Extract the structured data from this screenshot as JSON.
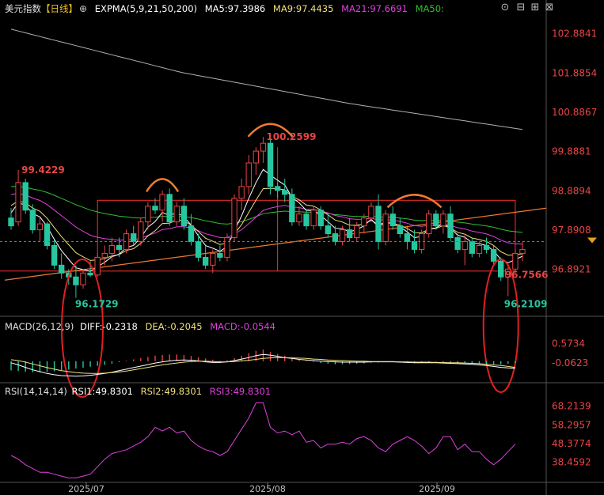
{
  "header": {
    "symbol": "美元指数",
    "period": "【日线】",
    "period_icon": "plus-circle-icon",
    "expma_label": "EXPMA(5,9,21,50,200)",
    "ma5": "MA5:97.3986",
    "ma9": "MA9:97.4435",
    "ma21": "MA21:97.6691",
    "ma50": "MA50:",
    "toolbar_icons": [
      "target-icon",
      "minus-box-icon",
      "plus-box-icon",
      "close-box-icon"
    ]
  },
  "colors": {
    "up": "#e84545",
    "down": "#26c6a0",
    "ma5": "#ffffff",
    "ma9": "#f0e080",
    "ma21": "#e040e0",
    "ma50": "#30c030",
    "ma200": "#b0b0b0",
    "orange": "#f07a30",
    "axis_text": "#e84545",
    "date_text": "#c0c0c0"
  },
  "chart_data": [
    {
      "type": "candlestick",
      "title": "美元指数【日线】",
      "y_ticks": [
        102.8841,
        101.8854,
        100.8867,
        99.8881,
        98.8894,
        97.8908,
        96.8921
      ],
      "ylim": [
        95.7,
        103.3
      ],
      "current_price": 97.6,
      "annotations": [
        {
          "label": "99.4229",
          "value": 99.4229
        },
        {
          "label": "96.1729",
          "value": 96.1729
        },
        {
          "label": "100.2599",
          "value": 100.2599
        },
        {
          "label": "96.7566",
          "value": 96.7566
        },
        {
          "label": "96.2109",
          "value": 96.2109
        }
      ],
      "candles": [
        {
          "o": 98.2,
          "h": 98.45,
          "l": 97.9,
          "c": 98.0
        },
        {
          "o": 98.1,
          "h": 99.42,
          "l": 98.0,
          "c": 99.1
        },
        {
          "o": 99.1,
          "h": 99.2,
          "l": 98.3,
          "c": 98.4
        },
        {
          "o": 98.4,
          "h": 98.55,
          "l": 97.8,
          "c": 97.9
        },
        {
          "o": 97.9,
          "h": 98.2,
          "l": 97.6,
          "c": 98.05
        },
        {
          "o": 98.05,
          "h": 98.1,
          "l": 97.4,
          "c": 97.5
        },
        {
          "o": 97.5,
          "h": 97.65,
          "l": 96.9,
          "c": 97.0
        },
        {
          "o": 97.0,
          "h": 97.3,
          "l": 96.65,
          "c": 96.8
        },
        {
          "o": 96.8,
          "h": 96.9,
          "l": 96.5,
          "c": 96.7
        },
        {
          "o": 96.7,
          "h": 97.0,
          "l": 96.17,
          "c": 96.5
        },
        {
          "o": 96.5,
          "h": 96.9,
          "l": 96.4,
          "c": 96.8
        },
        {
          "o": 96.8,
          "h": 97.1,
          "l": 96.7,
          "c": 96.75
        },
        {
          "o": 96.75,
          "h": 97.3,
          "l": 96.7,
          "c": 97.2
        },
        {
          "o": 97.2,
          "h": 97.5,
          "l": 97.0,
          "c": 97.3
        },
        {
          "o": 97.3,
          "h": 97.7,
          "l": 97.1,
          "c": 97.5
        },
        {
          "o": 97.5,
          "h": 97.7,
          "l": 97.2,
          "c": 97.4
        },
        {
          "o": 97.4,
          "h": 97.9,
          "l": 97.3,
          "c": 97.8
        },
        {
          "o": 97.8,
          "h": 98.0,
          "l": 97.5,
          "c": 97.6
        },
        {
          "o": 97.6,
          "h": 98.2,
          "l": 97.5,
          "c": 98.1
        },
        {
          "o": 98.1,
          "h": 98.6,
          "l": 97.9,
          "c": 98.5
        },
        {
          "o": 98.5,
          "h": 98.7,
          "l": 98.3,
          "c": 98.4
        },
        {
          "o": 98.4,
          "h": 98.9,
          "l": 98.1,
          "c": 98.8
        },
        {
          "o": 98.8,
          "h": 98.95,
          "l": 98.0,
          "c": 98.1
        },
        {
          "o": 98.1,
          "h": 98.6,
          "l": 98.0,
          "c": 98.5
        },
        {
          "o": 98.5,
          "h": 98.7,
          "l": 97.9,
          "c": 98.0
        },
        {
          "o": 98.0,
          "h": 98.3,
          "l": 97.5,
          "c": 97.6
        },
        {
          "o": 97.6,
          "h": 97.8,
          "l": 97.1,
          "c": 97.2
        },
        {
          "o": 97.2,
          "h": 97.5,
          "l": 96.9,
          "c": 97.0
        },
        {
          "o": 97.0,
          "h": 97.4,
          "l": 96.8,
          "c": 97.3
        },
        {
          "o": 97.3,
          "h": 97.5,
          "l": 97.1,
          "c": 97.2
        },
        {
          "o": 97.2,
          "h": 97.8,
          "l": 97.1,
          "c": 97.7
        },
        {
          "o": 97.7,
          "h": 98.8,
          "l": 97.6,
          "c": 98.7
        },
        {
          "o": 98.7,
          "h": 99.2,
          "l": 98.4,
          "c": 99.0
        },
        {
          "o": 99.0,
          "h": 99.8,
          "l": 98.8,
          "c": 99.6
        },
        {
          "o": 99.6,
          "h": 100.0,
          "l": 99.3,
          "c": 99.9
        },
        {
          "o": 99.9,
          "h": 100.26,
          "l": 99.6,
          "c": 100.1
        },
        {
          "o": 100.1,
          "h": 100.2,
          "l": 98.8,
          "c": 99.0
        },
        {
          "o": 99.0,
          "h": 99.1,
          "l": 98.7,
          "c": 98.9
        },
        {
          "o": 98.9,
          "h": 99.2,
          "l": 98.6,
          "c": 98.8
        },
        {
          "o": 98.8,
          "h": 98.95,
          "l": 98.0,
          "c": 98.1
        },
        {
          "o": 98.1,
          "h": 98.5,
          "l": 98.0,
          "c": 98.3
        },
        {
          "o": 98.3,
          "h": 98.4,
          "l": 97.9,
          "c": 98.0
        },
        {
          "o": 98.0,
          "h": 98.5,
          "l": 97.9,
          "c": 98.4
        },
        {
          "o": 98.4,
          "h": 98.5,
          "l": 97.9,
          "c": 98.0
        },
        {
          "o": 98.0,
          "h": 98.3,
          "l": 97.7,
          "c": 97.8
        },
        {
          "o": 97.8,
          "h": 98.0,
          "l": 97.5,
          "c": 97.6
        },
        {
          "o": 97.6,
          "h": 98.0,
          "l": 97.5,
          "c": 97.9
        },
        {
          "o": 97.9,
          "h": 98.2,
          "l": 97.6,
          "c": 97.7
        },
        {
          "o": 97.7,
          "h": 98.1,
          "l": 97.6,
          "c": 98.0
        },
        {
          "o": 98.0,
          "h": 98.3,
          "l": 97.8,
          "c": 98.2
        },
        {
          "o": 98.2,
          "h": 98.6,
          "l": 98.1,
          "c": 98.5
        },
        {
          "o": 98.5,
          "h": 98.8,
          "l": 97.4,
          "c": 97.6
        },
        {
          "o": 97.6,
          "h": 98.4,
          "l": 97.5,
          "c": 98.3
        },
        {
          "o": 98.3,
          "h": 98.5,
          "l": 97.9,
          "c": 98.0
        },
        {
          "o": 98.0,
          "h": 98.2,
          "l": 97.7,
          "c": 97.8
        },
        {
          "o": 97.8,
          "h": 98.0,
          "l": 97.4,
          "c": 97.6
        },
        {
          "o": 97.6,
          "h": 97.9,
          "l": 97.3,
          "c": 97.4
        },
        {
          "o": 97.4,
          "h": 97.9,
          "l": 97.3,
          "c": 97.8
        },
        {
          "o": 97.8,
          "h": 98.4,
          "l": 97.7,
          "c": 98.3
        },
        {
          "o": 98.3,
          "h": 98.4,
          "l": 97.9,
          "c": 98.0
        },
        {
          "o": 98.0,
          "h": 98.4,
          "l": 97.8,
          "c": 98.3
        },
        {
          "o": 98.3,
          "h": 98.5,
          "l": 97.6,
          "c": 97.7
        },
        {
          "o": 97.7,
          "h": 97.8,
          "l": 97.3,
          "c": 97.4
        },
        {
          "o": 97.4,
          "h": 97.8,
          "l": 97.0,
          "c": 97.6
        },
        {
          "o": 97.6,
          "h": 97.7,
          "l": 97.2,
          "c": 97.3
        },
        {
          "o": 97.3,
          "h": 97.6,
          "l": 97.2,
          "c": 97.5
        },
        {
          "o": 97.5,
          "h": 97.7,
          "l": 97.3,
          "c": 97.4
        },
        {
          "o": 97.4,
          "h": 97.5,
          "l": 97.0,
          "c": 97.1
        },
        {
          "o": 97.1,
          "h": 97.2,
          "l": 96.6,
          "c": 96.7
        },
        {
          "o": 96.7,
          "h": 97.0,
          "l": 96.21,
          "c": 96.9
        },
        {
          "o": 96.9,
          "h": 97.4,
          "l": 96.8,
          "c": 97.3
        },
        {
          "o": 97.3,
          "h": 97.6,
          "l": 97.1,
          "c": 97.4
        }
      ],
      "ema200": [
        103.0,
        101.9,
        101.1,
        100.45
      ],
      "rect_box": {
        "top": 98.65,
        "bottom": 96.85,
        "start_index": 12,
        "end_index": 70
      },
      "center_line_index": 37
    },
    {
      "type": "bar",
      "title": "MACD(26,12,9)",
      "legend": {
        "diff": "DIFF:-0.2318",
        "dea": "DEA:-0.2045",
        "macd": "MACD:-0.0544"
      },
      "y_ticks": [
        0.5734,
        -0.0623
      ],
      "ylim": [
        -0.65,
        0.95
      ],
      "hist": [
        -0.3,
        -0.32,
        -0.34,
        -0.36,
        -0.36,
        -0.35,
        -0.33,
        -0.3,
        -0.27,
        -0.24,
        -0.21,
        -0.18,
        -0.15,
        -0.12,
        -0.08,
        -0.03,
        0.02,
        0.06,
        0.1,
        0.14,
        0.18,
        0.2,
        0.22,
        0.22,
        0.2,
        0.17,
        0.13,
        0.09,
        0.05,
        0.02,
        0.04,
        0.1,
        0.18,
        0.26,
        0.34,
        0.38,
        0.3,
        0.24,
        0.18,
        0.12,
        0.06,
        0.02,
        -0.02,
        -0.06,
        -0.08,
        -0.1,
        -0.1,
        -0.09,
        -0.08,
        -0.07,
        -0.05,
        -0.04,
        -0.03,
        -0.02,
        -0.02,
        -0.03,
        -0.04,
        -0.03,
        -0.02,
        -0.02,
        -0.03,
        -0.04,
        -0.05,
        -0.06,
        -0.07,
        -0.08,
        -0.09,
        -0.1,
        -0.1,
        -0.08,
        -0.06
      ],
      "diff": [
        -0.05,
        -0.12,
        -0.2,
        -0.28,
        -0.34,
        -0.4,
        -0.44,
        -0.47,
        -0.48,
        -0.49,
        -0.48,
        -0.46,
        -0.43,
        -0.4,
        -0.36,
        -0.31,
        -0.26,
        -0.21,
        -0.16,
        -0.11,
        -0.06,
        -0.02,
        0.01,
        0.03,
        0.04,
        0.03,
        0.01,
        -0.02,
        -0.04,
        -0.04,
        -0.02,
        0.02,
        0.07,
        0.12,
        0.18,
        0.22,
        0.2,
        0.16,
        0.12,
        0.09,
        0.06,
        0.04,
        0.02,
        0.0,
        -0.01,
        -0.02,
        -0.03,
        -0.03,
        -0.03,
        -0.03,
        -0.02,
        -0.02,
        -0.02,
        -0.02,
        -0.03,
        -0.04,
        -0.05,
        -0.05,
        -0.05,
        -0.05,
        -0.06,
        -0.07,
        -0.08,
        -0.09,
        -0.1,
        -0.12,
        -0.14,
        -0.17,
        -0.2,
        -0.22,
        -0.23
      ],
      "dea": [
        0.05,
        0.02,
        -0.03,
        -0.09,
        -0.15,
        -0.21,
        -0.26,
        -0.31,
        -0.34,
        -0.37,
        -0.39,
        -0.4,
        -0.4,
        -0.39,
        -0.37,
        -0.35,
        -0.32,
        -0.28,
        -0.24,
        -0.2,
        -0.16,
        -0.12,
        -0.09,
        -0.06,
        -0.03,
        -0.01,
        0.0,
        0.0,
        -0.01,
        -0.02,
        -0.02,
        -0.01,
        0.01,
        0.03,
        0.06,
        0.09,
        0.11,
        0.12,
        0.12,
        0.11,
        0.1,
        0.09,
        0.07,
        0.06,
        0.04,
        0.03,
        0.02,
        0.01,
        0.0,
        0.0,
        -0.01,
        -0.01,
        -0.01,
        -0.01,
        -0.02,
        -0.02,
        -0.03,
        -0.03,
        -0.03,
        -0.04,
        -0.04,
        -0.05,
        -0.05,
        -0.06,
        -0.07,
        -0.08,
        -0.1,
        -0.12,
        -0.14,
        -0.17,
        -0.2
      ]
    },
    {
      "type": "line",
      "title": "RSI(14,14,14)",
      "legend": {
        "rsi1": "RSI1:49.8301",
        "rsi2": "RSI2:49.8301",
        "rsi3": "RSI3:49.8301"
      },
      "y_ticks": [
        68.2139,
        58.2957,
        48.3774,
        38.4592
      ],
      "ylim": [
        28.5,
        74
      ],
      "values": [
        42,
        40,
        37,
        35,
        33,
        33,
        32,
        31,
        30,
        30,
        31,
        32,
        36,
        40,
        43,
        44,
        45,
        47,
        49,
        52,
        57,
        55,
        57,
        54,
        55,
        50,
        47,
        45,
        44,
        42,
        44,
        50,
        56,
        62,
        70,
        70,
        57,
        54,
        55,
        53,
        55,
        49,
        50,
        46,
        48,
        48,
        49,
        48,
        51,
        52,
        50,
        46,
        44,
        48,
        50,
        52,
        50,
        47,
        43,
        46,
        52,
        52,
        45,
        48,
        44,
        44,
        40,
        37,
        40,
        44,
        48
      ]
    }
  ],
  "dates": [
    "2025/07",
    "2025/08",
    "2025/09"
  ]
}
